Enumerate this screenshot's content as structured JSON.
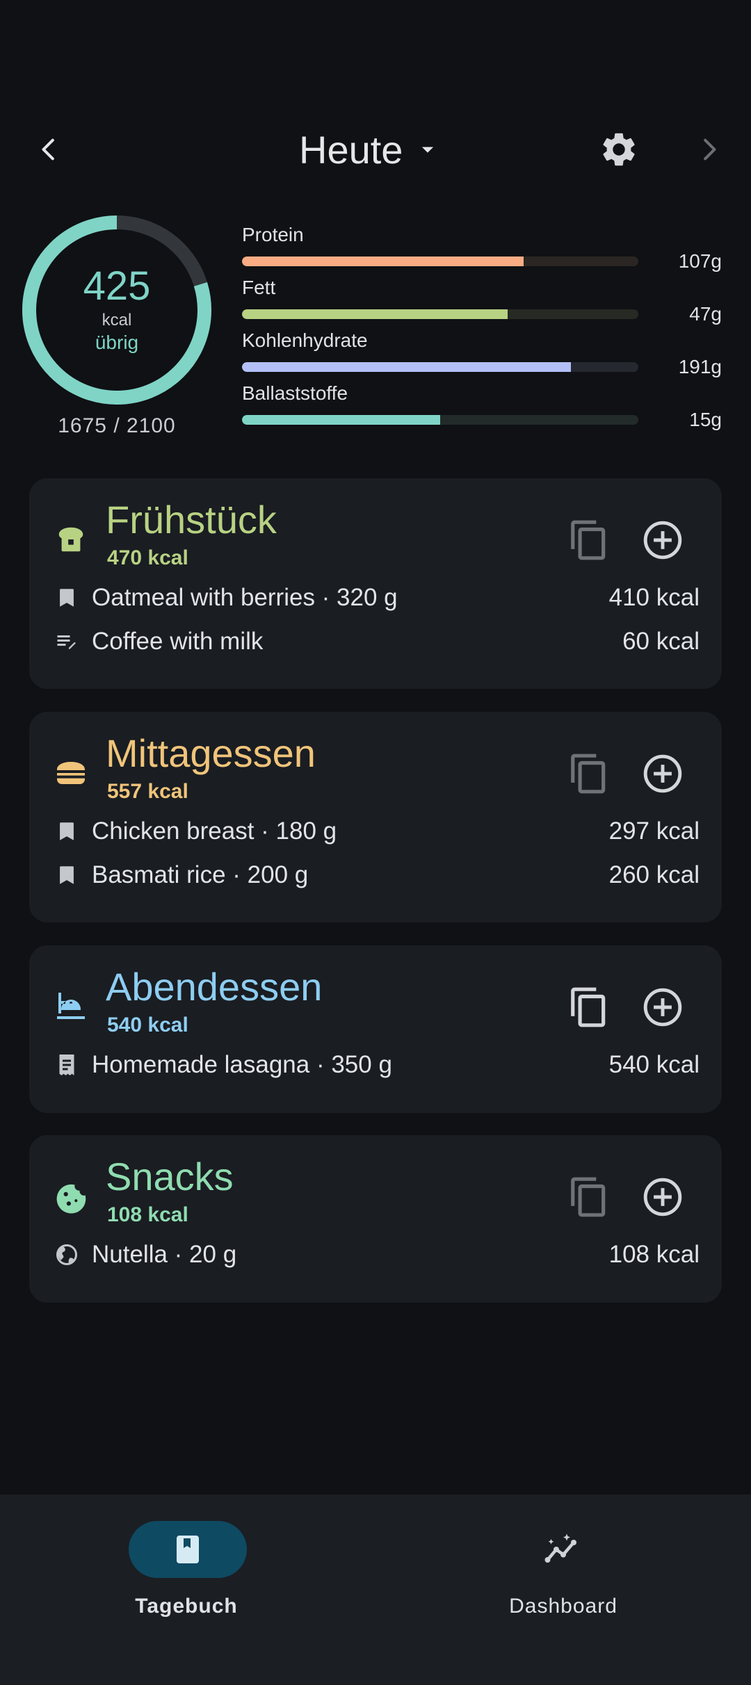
{
  "header": {
    "title": "Heute"
  },
  "summary": {
    "remaining_value": "425",
    "remaining_unit": "kcal",
    "remaining_label": "übrig",
    "consumed_total": "1675 / 2100",
    "ring_fraction": 0.7976,
    "ring_color": "#7fd4c6",
    "macros": [
      {
        "name": "Protein",
        "value": "107g",
        "fraction": 0.71,
        "color": "#f9ac84",
        "track": "#2b2623"
      },
      {
        "name": "Fett",
        "value": "47g",
        "fraction": 0.67,
        "color": "#b8d283",
        "track": "#272a24"
      },
      {
        "name": "Kohlenhydrate",
        "value": "191g",
        "fraction": 0.83,
        "color": "#b3c0f7",
        "track": "#25282f"
      },
      {
        "name": "Ballaststoffe",
        "value": "15g",
        "fraction": 0.5,
        "color": "#7fd4c6",
        "track": "#222b2a"
      }
    ]
  },
  "meals": [
    {
      "title": "Frühstück",
      "kcal": "470 kcal",
      "color": "#b8d283",
      "icon": "toast-icon",
      "entries": [
        {
          "icon": "bookmark-icon",
          "name": "Oatmeal with berries · 320 g",
          "kcal": "410 kcal"
        },
        {
          "icon": "edit-note-icon",
          "name": "Coffee with milk",
          "kcal": "60 kcal"
        }
      ]
    },
    {
      "title": "Mittagessen",
      "kcal": "557 kcal",
      "color": "#f0c47a",
      "icon": "burger-icon",
      "entries": [
        {
          "icon": "bookmark-icon",
          "name": "Chicken breast · 180 g",
          "kcal": "297 kcal"
        },
        {
          "icon": "bookmark-icon",
          "name": "Basmati rice · 200 g",
          "kcal": "260 kcal"
        }
      ]
    },
    {
      "title": "Abendessen",
      "kcal": "540 kcal",
      "color": "#8ecdf2",
      "icon": "dinner-icon",
      "entries": [
        {
          "icon": "receipt-icon",
          "name": "Homemade lasagna · 350 g",
          "kcal": "540 kcal"
        }
      ]
    },
    {
      "title": "Snacks",
      "kcal": "108 kcal",
      "color": "#8fdcb0",
      "icon": "cookie-icon",
      "entries": [
        {
          "icon": "globe-icon",
          "name": "Nutella · 20 g",
          "kcal": "108 kcal"
        }
      ]
    }
  ],
  "bottom_nav": {
    "items": [
      {
        "label": "Tagebuch",
        "active": true,
        "icon": "book-icon"
      },
      {
        "label": "Dashboard",
        "active": false,
        "icon": "insights-icon"
      }
    ],
    "active_pill_color": "#0e4a62"
  }
}
